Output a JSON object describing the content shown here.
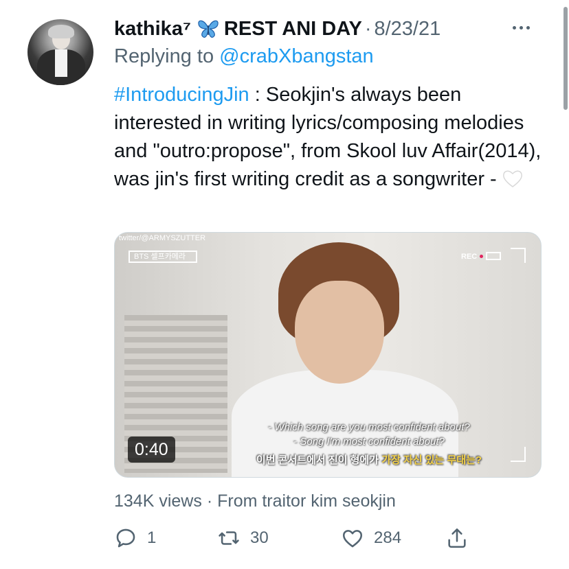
{
  "tweet": {
    "author_name": "kathika⁷",
    "author_badge_icon": "blue-butterfly-icon",
    "author_suffix": "REST ANI DAY",
    "dot": "·",
    "date": "8/23/21",
    "replying_prefix": "Replying to",
    "replying_handle": "@crabXbangstan",
    "hashtag": "#IntroducingJin",
    "text": " : Seokjin's always been interested in writing lyrics/composing melodies and \"outro:propose\", from Skool luv Affair(2014), was jin's first writing credit as a songwriter -",
    "text_emoji_icon": "white-heart-icon"
  },
  "media": {
    "duration": "0:40",
    "watermark": "twitter/@ARMYSZUTTER",
    "overlay_tag": "BTS 셀프카메라",
    "rec_label": "REC",
    "subtitle_1": "- Which song are you most confident about?",
    "subtitle_2": "- Song I'm most confident about?",
    "subtitle_3_plain": "이번 콘서트에서 진이 형에가 ",
    "subtitle_3_highlight": "가장 자신 있는 무대는?"
  },
  "footer": {
    "views": "134K views",
    "dot": "·",
    "source": "From traitor kim seokjin"
  },
  "actions": {
    "reply_count": "1",
    "retweet_count": "30",
    "like_count": "284"
  },
  "colors": {
    "link": "#1d9bf0",
    "secondary": "#536471",
    "text": "#0f1419"
  }
}
